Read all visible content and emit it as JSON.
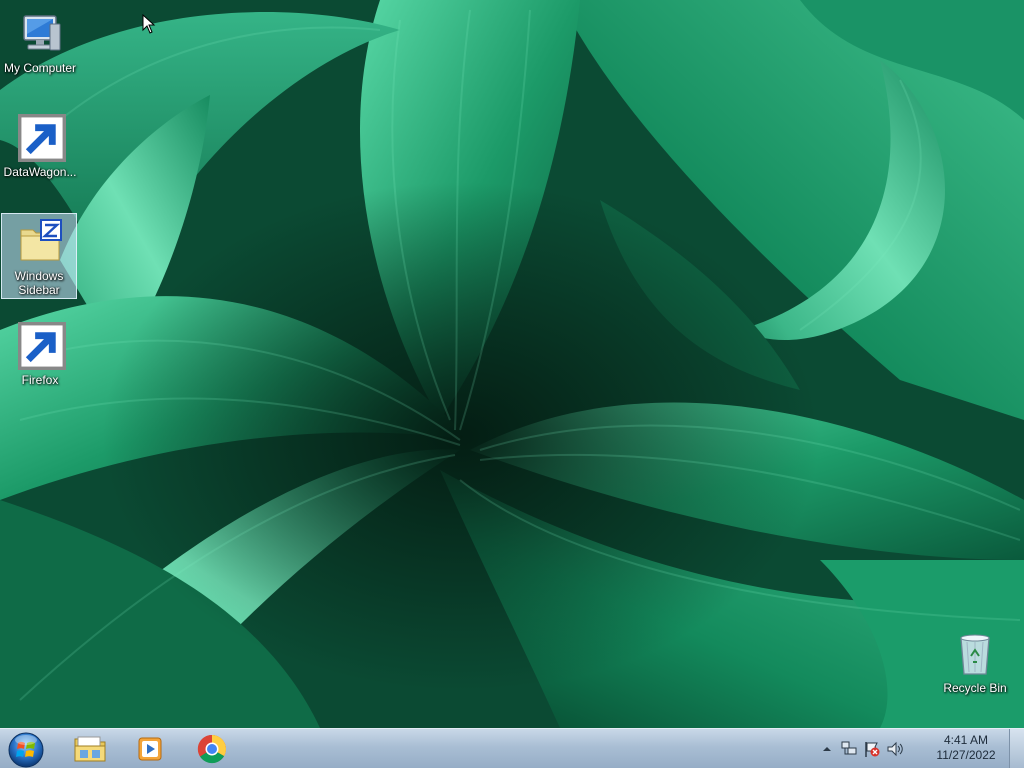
{
  "desktop": {
    "icons": [
      {
        "label": "My Computer",
        "icon": "computer-icon",
        "shortcut": false
      },
      {
        "label": "DataWagon...",
        "icon": "datawagon-icon",
        "shortcut": true
      },
      {
        "label": "Windows Sidebar",
        "icon": "folder-zip-icon",
        "shortcut": false,
        "selected": true
      },
      {
        "label": "Firefox",
        "icon": "firefox-icon",
        "shortcut": true
      },
      {
        "label": "Recycle Bin",
        "icon": "recycle-bin-icon",
        "shortcut": false
      }
    ]
  },
  "taskbar": {
    "start_icon": "windows-orb-icon",
    "pinned": [
      {
        "name": "Windows Explorer",
        "icon": "folder-icon"
      },
      {
        "name": "Windows Media Player",
        "icon": "media-player-icon"
      },
      {
        "name": "Google Chrome",
        "icon": "chrome-icon"
      }
    ],
    "tray": {
      "icons": [
        "show-hidden-icons-icon",
        "network-icon",
        "action-center-flag-icon",
        "volume-icon"
      ],
      "time": "4:41 AM",
      "date": "11/27/2022"
    }
  },
  "colors": {
    "wallpaper_dark": "#0a3f2c",
    "wallpaper_leaf": "#1f9e6b",
    "wallpaper_light": "#4fd6a2",
    "taskbar": "#a9bed4",
    "selection": "#cde6ff"
  }
}
